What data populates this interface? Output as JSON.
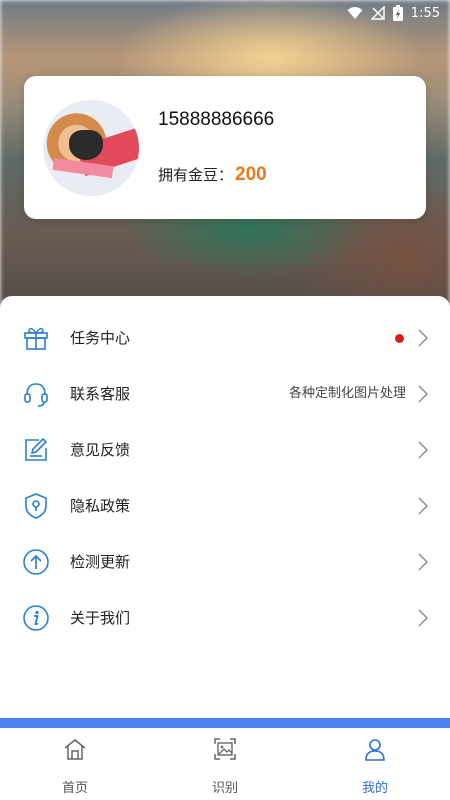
{
  "status_bar": {
    "time": "1:55",
    "icons": [
      "wifi-icon",
      "no-signal-icon",
      "battery-charging-icon"
    ]
  },
  "profile": {
    "phone": "15888886666",
    "coins_label": "拥有金豆：",
    "coins_value": "200",
    "coins_color": "#e87a1a"
  },
  "menu": {
    "items": [
      {
        "label": "任务中心",
        "icon": "gift-icon",
        "badge": "red-dot",
        "extra": ""
      },
      {
        "label": "联系客服",
        "icon": "headset-icon",
        "badge": "",
        "extra": "各种定制化图片处理"
      },
      {
        "label": "意见反馈",
        "icon": "edit-icon",
        "badge": "",
        "extra": ""
      },
      {
        "label": "隐私政策",
        "icon": "shield-icon",
        "badge": "",
        "extra": ""
      },
      {
        "label": "检测更新",
        "icon": "upload-arrow-icon",
        "badge": "",
        "extra": ""
      },
      {
        "label": "关于我们",
        "icon": "info-icon",
        "badge": "",
        "extra": ""
      }
    ]
  },
  "tabbar": {
    "tabs": [
      {
        "label": "首页",
        "icon": "home-icon",
        "active": false
      },
      {
        "label": "识别",
        "icon": "scan-image-icon",
        "active": false
      },
      {
        "label": "我的",
        "icon": "user-icon",
        "active": true
      }
    ]
  },
  "colors": {
    "accent": "#2f6fd6",
    "icon_blue": "#2a7fd0",
    "tab_strip": "#4c7ff0",
    "badge_red": "#e01818"
  }
}
